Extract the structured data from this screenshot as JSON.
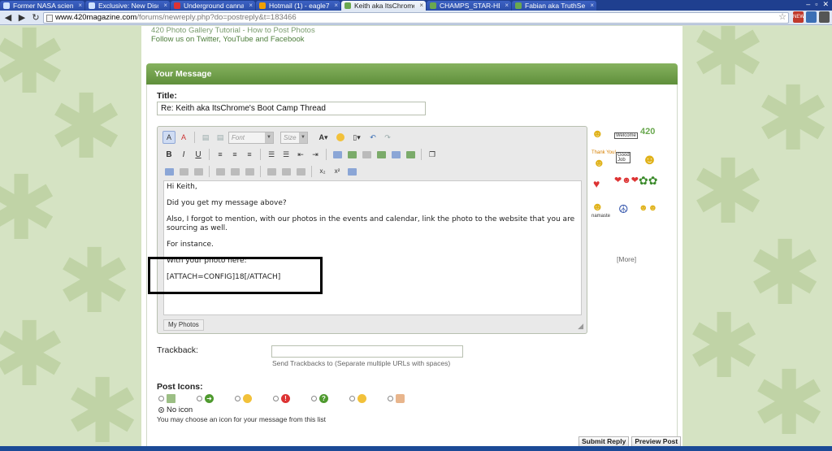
{
  "browser": {
    "tabs": [
      {
        "label": "Former NASA scienti",
        "favicon": "blue"
      },
      {
        "label": "Exclusive: New Disco",
        "favicon": "blue"
      },
      {
        "label": "Underground cannab",
        "favicon": "red"
      },
      {
        "label": "Hotmail (1) - eagle7",
        "favicon": "orange"
      },
      {
        "label": "Keith aka ItsChrome",
        "favicon": "green",
        "active": true
      },
      {
        "label": "CHAMPS_STAR-HEA",
        "favicon": "green"
      },
      {
        "label": "Fabian aka TruthSee",
        "favicon": "green"
      }
    ],
    "url_host": "www.420magazine.com",
    "url_path": "/forums/newreply.php?do=postreply&t=183466",
    "toolbar_badge": "NEW"
  },
  "top_links": {
    "gallery_tutorial": "420 Photo Gallery Tutorial - How to Post Photos",
    "follow": "Follow us on Twitter, YouTube and Facebook"
  },
  "form": {
    "section_title": "Your Message",
    "title_label": "Title:",
    "title_value": "Re: Keith aka ItsChrome's Boot Camp Thread",
    "font_placeholder": "Font",
    "size_placeholder": "Size",
    "message_lines": [
      "Hi Keith,",
      "Did you get my message above?",
      "Also, I forgot to mention, with our photos in the events and calendar, link the photo to the website that you are sourcing as well.",
      "For instance.",
      "With your photo here:",
      "[ATTACH=CONFIG]18[/ATTACH]"
    ],
    "my_photos_tab": "My Photos",
    "smilies_more": "[More]",
    "smilie_labels": {
      "welcome": "Welcome",
      "good_job": "Good Job",
      "thank_you": "Thank You!",
      "namaste": "namaste",
      "brand": "420"
    },
    "trackback_label": "Trackback:",
    "trackback_help": "Send Trackbacks to (Separate multiple URLs with spaces)",
    "post_icons_label": "Post Icons:",
    "no_icon_label": "No icon",
    "post_icons_help": "You may choose an icon for your message from this list",
    "submit_label": "Submit Reply",
    "preview_label": "Preview Post"
  }
}
